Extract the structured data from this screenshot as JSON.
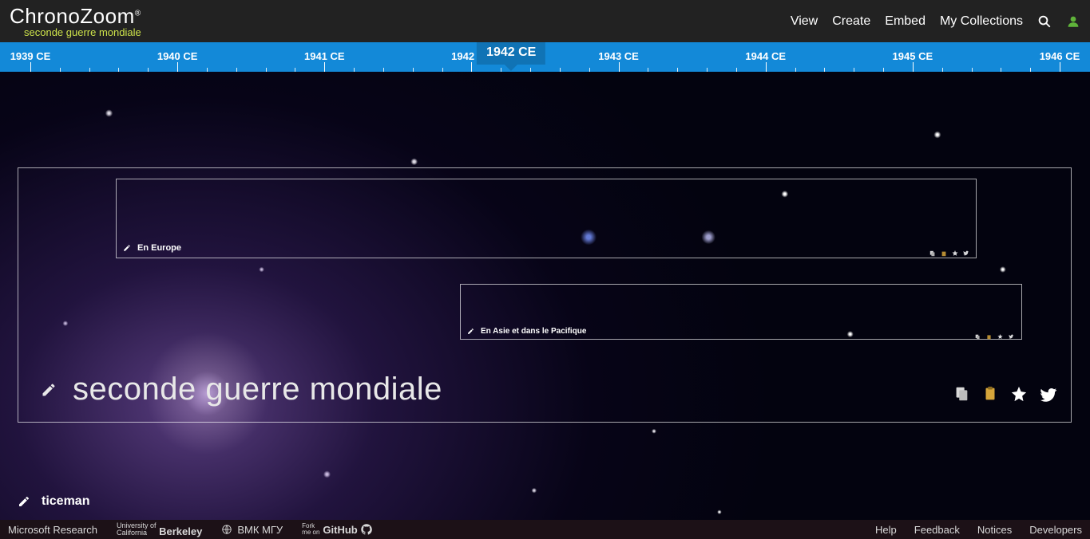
{
  "header": {
    "logo_text": "ChronoZoom",
    "logo_reg": "®",
    "subtitle": "seconde guerre mondiale",
    "nav": [
      "View",
      "Create",
      "Embed",
      "My Collections"
    ]
  },
  "ruler": {
    "years": [
      "1939 CE",
      "1940 CE",
      "1941 CE",
      "1942 CE",
      "1943 CE",
      "1944 CE",
      "1945 CE",
      "1946 CE"
    ],
    "current": "1942 CE",
    "current_pos_pct": 46.9
  },
  "timelines": {
    "main_title": "seconde guerre mondiale",
    "sub1_title": "En Europe",
    "sub2_title": "En Asie et dans le Pacifique"
  },
  "author": "ticeman",
  "footer": {
    "left": [
      "Microsoft Research",
      "University of California Berkeley",
      "ВМК МГУ",
      "Fork me on GitHub"
    ],
    "berkeley_prefix": "University of",
    "berkeley_main": "Berkeley",
    "bmk": "ВМК МГУ",
    "gh_prefix": "Fork me on",
    "gh_main": "GitHub",
    "ms": "Microsoft Research",
    "right": [
      "Help",
      "Feedback",
      "Notices",
      "Developers"
    ]
  }
}
